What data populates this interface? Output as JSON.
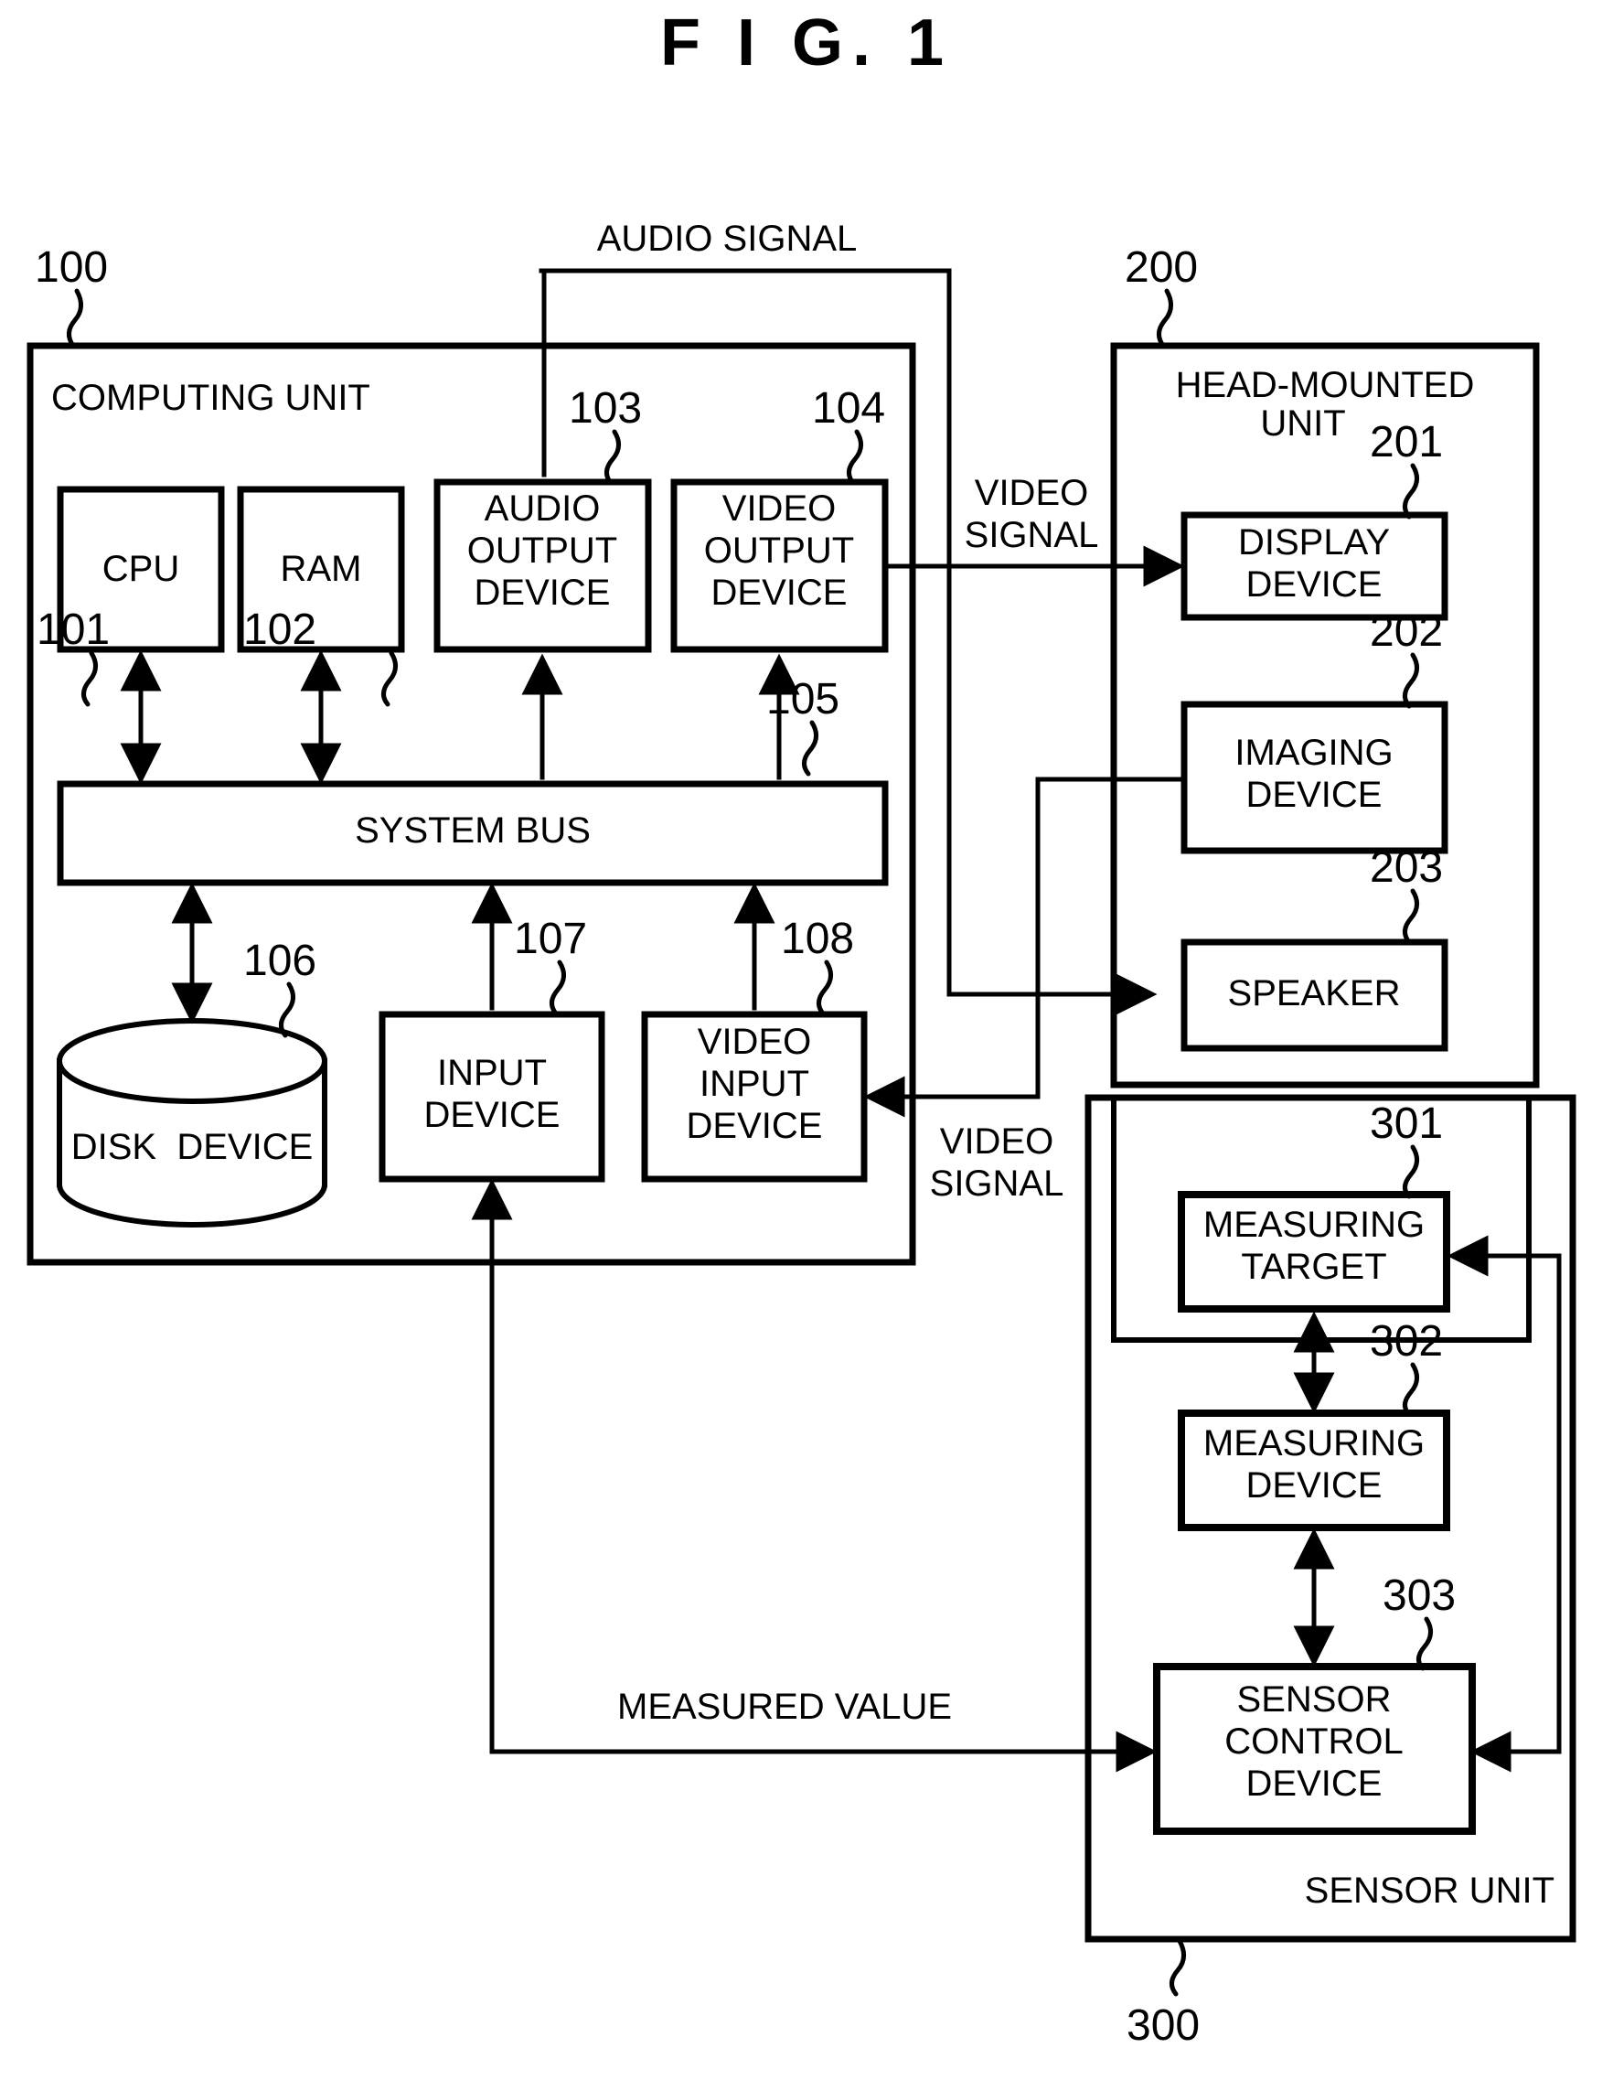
{
  "figure": {
    "title": "F I G.  1",
    "title_plain": "FIG. 1"
  },
  "units": [
    {
      "id": "computing",
      "ref": "100",
      "label": "COMPUTING UNIT"
    },
    {
      "id": "head_mounted",
      "ref": "200",
      "label_line1": "HEAD-MOUNTED",
      "label_line2": "UNIT"
    },
    {
      "id": "sensor",
      "ref": "300",
      "label": "SENSOR UNIT"
    }
  ],
  "blocks": {
    "cpu": {
      "ref": "101",
      "line1": "CPU"
    },
    "ram": {
      "ref": "102",
      "line1": "RAM"
    },
    "audio_output": {
      "ref": "103",
      "line1": "AUDIO",
      "line2": "OUTPUT",
      "line3": "DEVICE"
    },
    "video_output": {
      "ref": "104",
      "line1": "VIDEO",
      "line2": "OUTPUT",
      "line3": "DEVICE"
    },
    "system_bus": {
      "ref": "105",
      "line1": "SYSTEM BUS"
    },
    "disk_device": {
      "ref": "106",
      "line1": "DISK  DEVICE"
    },
    "input_device": {
      "ref": "107",
      "line1": "INPUT",
      "line2": "DEVICE"
    },
    "video_input": {
      "ref": "108",
      "line1": "VIDEO",
      "line2": "INPUT",
      "line3": "DEVICE"
    },
    "display_device": {
      "ref": "201",
      "line1": "DISPLAY",
      "line2": "DEVICE"
    },
    "imaging_device": {
      "ref": "202",
      "line1": "IMAGING",
      "line2": "DEVICE"
    },
    "speaker": {
      "ref": "203",
      "line1": "SPEAKER"
    },
    "measuring_target": {
      "ref": "301",
      "line1": "MEASURING",
      "line2": "TARGET"
    },
    "measuring_device": {
      "ref": "302",
      "line1": "MEASURING",
      "line2": "DEVICE"
    },
    "sensor_control": {
      "ref": "303",
      "line1": "SENSOR",
      "line2": "CONTROL",
      "line3": "DEVICE"
    }
  },
  "signals": {
    "audio_signal": "AUDIO SIGNAL",
    "video_signal_out_line1": "VIDEO",
    "video_signal_out_line2": "SIGNAL",
    "video_signal_in_line1": "VIDEO",
    "video_signal_in_line2": "SIGNAL",
    "measured_value": "MEASURED VALUE"
  },
  "colors": {
    "ink": "#000000",
    "paper": "#ffffff"
  }
}
